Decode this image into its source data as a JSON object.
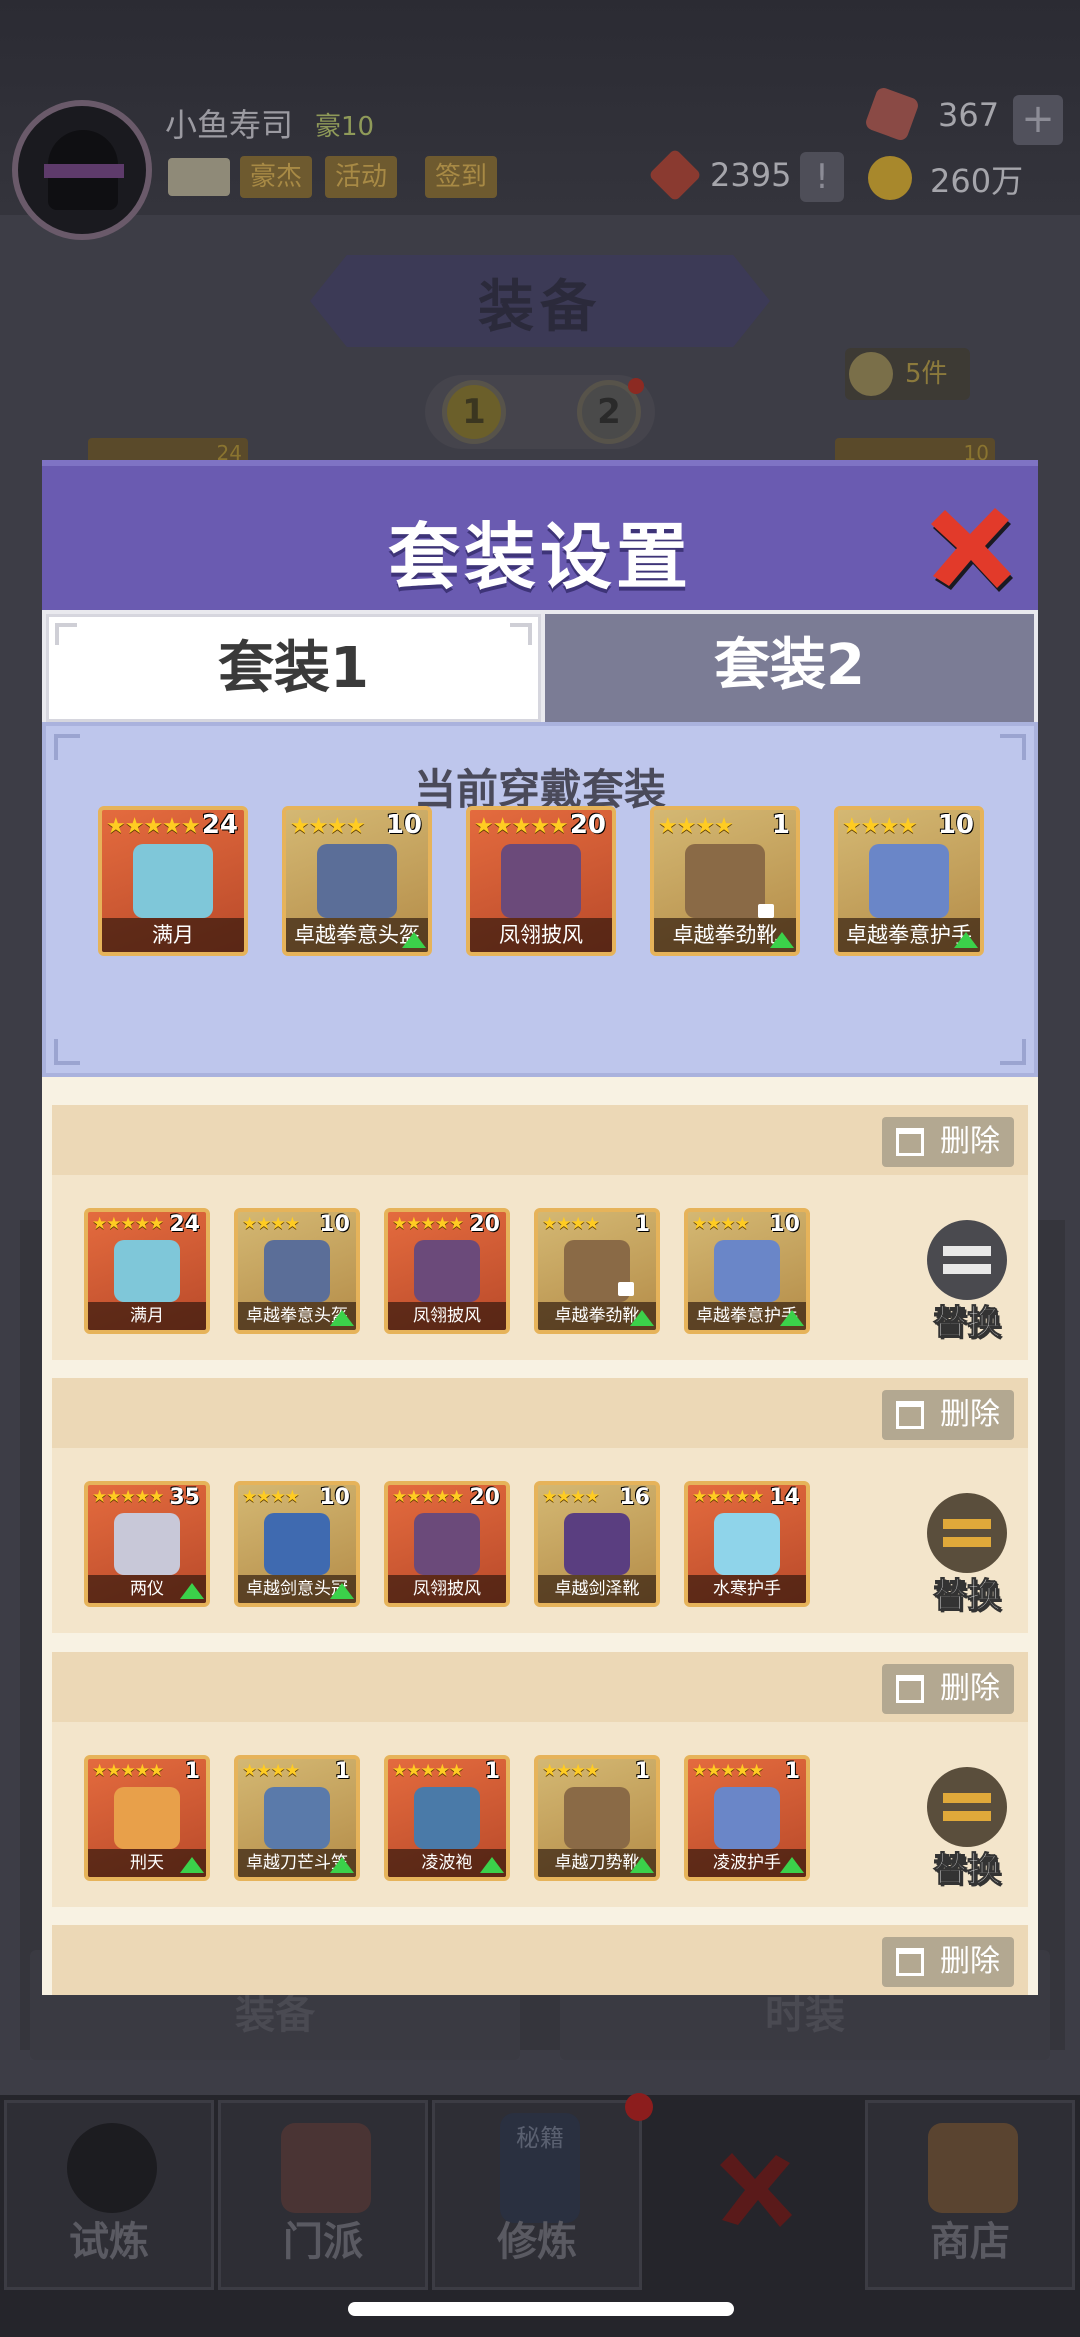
{
  "header": {
    "username": "小鱼寿司",
    "level": "豪10",
    "buttons": [
      "豪杰",
      "活动",
      "签到"
    ],
    "gems": "367",
    "tokens": "2395",
    "gold": "260万",
    "plus": "+",
    "notice": "!"
  },
  "background": {
    "banner": "装备",
    "pages": [
      "1",
      "2"
    ],
    "item_count": "5件",
    "left_level": "24",
    "right_level": "10"
  },
  "modal": {
    "title": "套装设置",
    "tabs": [
      "套装1",
      "套装2"
    ],
    "current_title": "当前穿戴套装",
    "delete_label": "删除",
    "swap_label": "替换",
    "current_items": [
      {
        "name": "满月",
        "level": "24",
        "stars": 5,
        "kind": "orb",
        "upgradable": false,
        "locked": false
      },
      {
        "name": "卓越拳意头盔",
        "level": "10",
        "stars": 4,
        "kind": "helmet",
        "upgradable": true,
        "locked": false
      },
      {
        "name": "凤翎披风",
        "level": "20",
        "stars": 5,
        "kind": "cloak",
        "upgradable": false,
        "locked": false
      },
      {
        "name": "卓越拳劲靴",
        "level": "1",
        "stars": 4,
        "kind": "boot",
        "upgradable": true,
        "locked": true
      },
      {
        "name": "卓越拳意护手",
        "level": "10",
        "stars": 4,
        "kind": "gauntlet",
        "upgradable": true,
        "locked": false
      }
    ],
    "sets": [
      {
        "items": [
          {
            "name": "满月",
            "level": "24",
            "stars": 5,
            "kind": "orb",
            "upgradable": false,
            "locked": false
          },
          {
            "name": "卓越拳意头盔",
            "level": "10",
            "stars": 4,
            "kind": "helmet",
            "upgradable": true,
            "locked": false
          },
          {
            "name": "凤翎披风",
            "level": "20",
            "stars": 5,
            "kind": "cloak",
            "upgradable": false,
            "locked": false
          },
          {
            "name": "卓越拳劲靴",
            "level": "1",
            "stars": 4,
            "kind": "boot",
            "upgradable": true,
            "locked": true
          },
          {
            "name": "卓越拳意护手",
            "level": "10",
            "stars": 4,
            "kind": "gauntlet",
            "upgradable": true,
            "locked": false
          }
        ]
      },
      {
        "items": [
          {
            "name": "两仪",
            "level": "35",
            "stars": 5,
            "kind": "sword",
            "upgradable": true,
            "locked": false
          },
          {
            "name": "卓越剑意头冠",
            "level": "10",
            "stars": 4,
            "kind": "crown",
            "upgradable": true,
            "locked": false
          },
          {
            "name": "凤翎披风",
            "level": "20",
            "stars": 5,
            "kind": "cloak",
            "upgradable": false,
            "locked": false
          },
          {
            "name": "卓越剑泽靴",
            "level": "16",
            "stars": 4,
            "kind": "boot-purple",
            "upgradable": false,
            "locked": false
          },
          {
            "name": "水寒护手",
            "level": "14",
            "stars": 5,
            "kind": "gem-gauntlet",
            "upgradable": false,
            "locked": false
          }
        ]
      },
      {
        "items": [
          {
            "name": "刑天",
            "level": "1",
            "stars": 5,
            "kind": "axe",
            "upgradable": true,
            "locked": false
          },
          {
            "name": "卓越刀芒斗笠",
            "level": "1",
            "stars": 4,
            "kind": "hat",
            "upgradable": true,
            "locked": false
          },
          {
            "name": "凌波袍",
            "level": "1",
            "stars": 5,
            "kind": "robe",
            "upgradable": true,
            "locked": false
          },
          {
            "name": "卓越刀势靴",
            "level": "1",
            "stars": 4,
            "kind": "boot",
            "upgradable": true,
            "locked": false
          },
          {
            "name": "凌波护手",
            "level": "1",
            "stars": 5,
            "kind": "gauntlet",
            "upgradable": true,
            "locked": false
          }
        ]
      },
      {
        "items": []
      }
    ]
  },
  "nav": {
    "items": [
      "试炼",
      "门派",
      "修炼",
      "",
      "商店"
    ],
    "book_label": "秘籍",
    "bg_tabs": [
      "装备",
      "时装"
    ]
  },
  "colors": {
    "modal_header": "#6a5bb1",
    "current_panel": "#bec6ec",
    "card_border": "#e6b35a",
    "upgrade_arrow": "#3bd14a"
  }
}
